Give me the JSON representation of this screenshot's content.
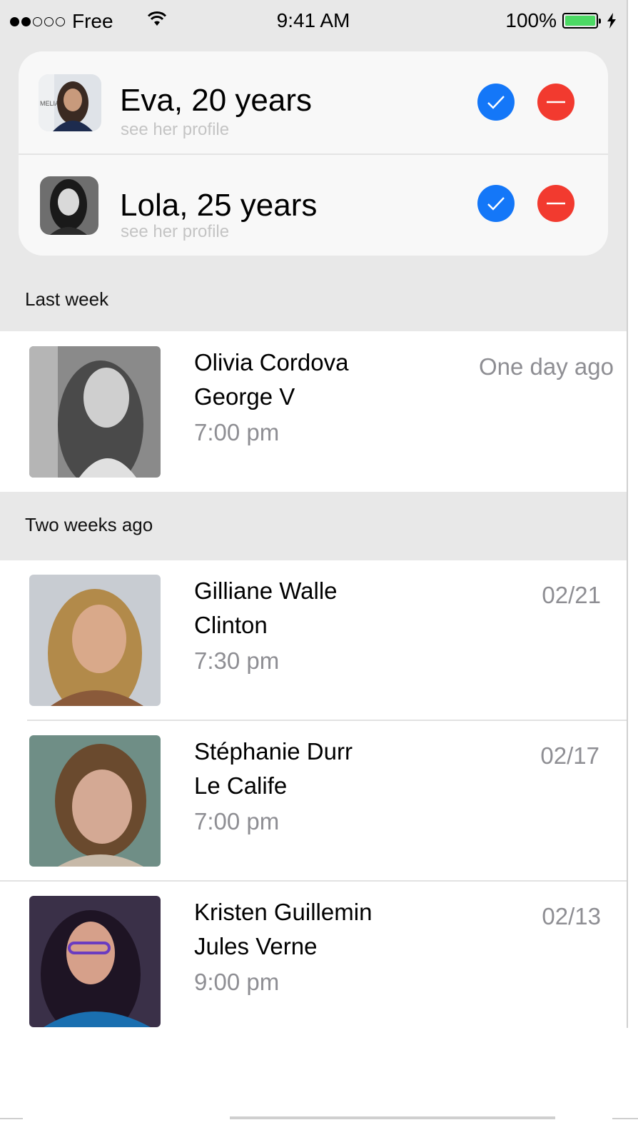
{
  "status_bar": {
    "signal_dots": [
      true,
      true,
      false,
      false,
      false
    ],
    "carrier": "Free",
    "time": "9:41 AM",
    "battery": "100%",
    "battery_color": "#4cd964"
  },
  "requests": [
    {
      "title": "Eva, 20 years",
      "subtitle": "see her profile",
      "avatar": "portrait-dark-hair-event"
    },
    {
      "title": "Lola, 25 years",
      "subtitle": "see her profile",
      "avatar": "portrait-bw"
    }
  ],
  "accent": {
    "accept": "#1477f8",
    "decline": "#f23a2f"
  },
  "sections": [
    {
      "label": "Last week",
      "items": [
        {
          "name": "Olivia Cordova",
          "place": "George V",
          "time": "7:00 pm",
          "date": "One day ago"
        }
      ]
    },
    {
      "label": "Two weeks ago",
      "items": [
        {
          "name": "Gilliane Walle",
          "place": "Clinton",
          "time": "7:30 pm",
          "date": "02/21"
        },
        {
          "name": "Stéphanie Durr",
          "place": "Le Calife",
          "time": "7:00 pm",
          "date": "02/17"
        },
        {
          "name": "Kristen Guillemin",
          "place": "Jules Verne",
          "time": "9:00 pm",
          "date": "02/13"
        }
      ]
    }
  ]
}
